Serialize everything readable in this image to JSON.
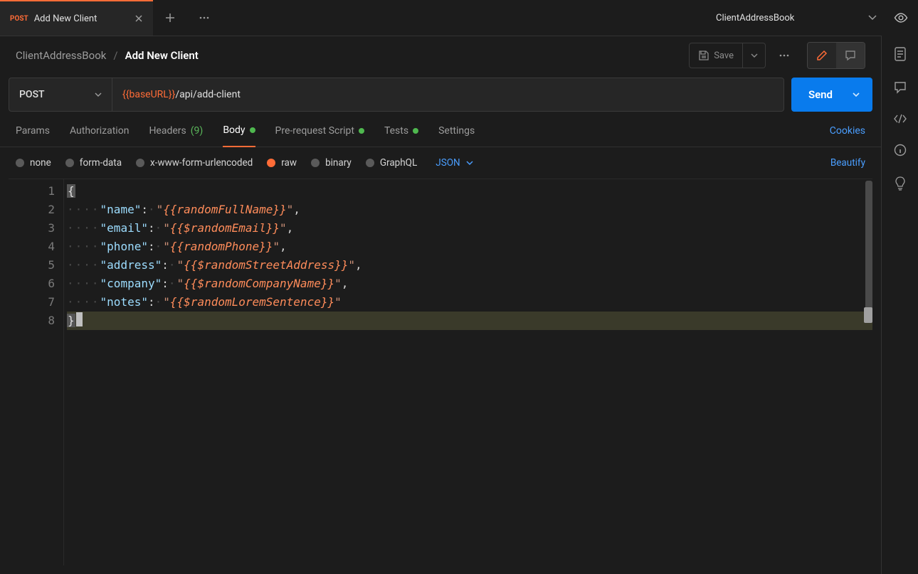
{
  "tab": {
    "method": "POST",
    "title": "Add New Client"
  },
  "environment": {
    "name": "ClientAddressBook"
  },
  "breadcrumb": {
    "parent": "ClientAddressBook",
    "current": "Add New Client"
  },
  "toolbar": {
    "save_label": "Save"
  },
  "request": {
    "method": "POST",
    "url_variable": "{{baseURL}}",
    "url_path": "/api/add-client",
    "send_label": "Send"
  },
  "tabs": {
    "params": "Params",
    "authorization": "Authorization",
    "headers_label": "Headers",
    "headers_count": "(9)",
    "body": "Body",
    "prerequest": "Pre-request Script",
    "tests": "Tests",
    "settings": "Settings",
    "cookies": "Cookies"
  },
  "body_types": {
    "none": "none",
    "form_data": "form-data",
    "x_www": "x-www-form-urlencoded",
    "raw": "raw",
    "binary": "binary",
    "graphql": "GraphQL",
    "content_type": "JSON",
    "beautify": "Beautify"
  },
  "editor": {
    "line_numbers": [
      "1",
      "2",
      "3",
      "4",
      "5",
      "6",
      "7",
      "8"
    ],
    "json_body": {
      "name": {
        "key": "name",
        "value": "{{randomFullName}}"
      },
      "email": {
        "key": "email",
        "value": "{{$randomEmail}}"
      },
      "phone": {
        "key": "phone",
        "value": "{{randomPhone}}"
      },
      "address": {
        "key": "address",
        "value": "{{$randomStreetAddress}}"
      },
      "company": {
        "key": "company",
        "value": "{{$randomCompanyName}}"
      },
      "notes": {
        "key": "notes",
        "value": "{{$randomLoremSentence}}"
      }
    }
  }
}
